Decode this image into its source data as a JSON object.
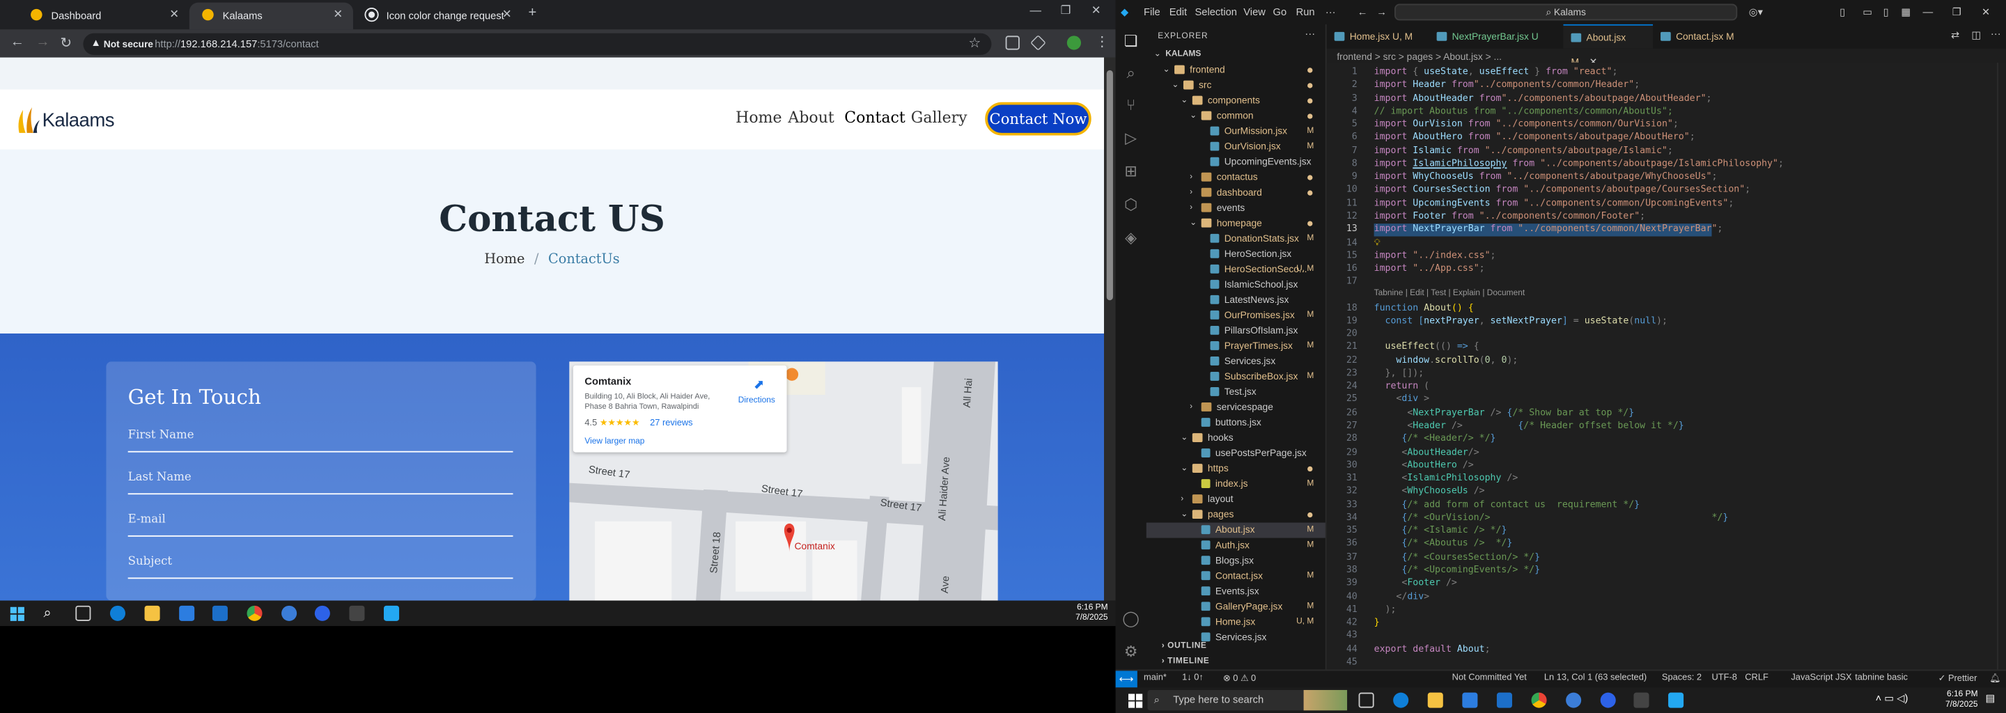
{
  "browser": {
    "tabs": [
      {
        "title": "Dashboard",
        "icon": "kalaams-favicon"
      },
      {
        "title": "Kalaams",
        "icon": "kalaams-favicon"
      },
      {
        "title": "Icon color change request",
        "icon": "chatgpt-icon"
      }
    ],
    "not_secure": "Not secure",
    "url_prefix": "http://",
    "url_host": "192.168.214.157",
    "url_path": ":5173/contact"
  },
  "site": {
    "logo_text": "Kalaams",
    "nav": [
      "Home",
      "About",
      "Contact",
      "Gallery"
    ],
    "cta": "Contact Now",
    "hero_title": "Contact US",
    "crumb_home": "Home",
    "crumb_sep": "/",
    "crumb_current": "ContactUs",
    "form_title": "Get In Touch",
    "form_fields": [
      "First Name",
      "Last Name",
      "E-mail",
      "Subject"
    ],
    "map": {
      "name": "Comtanix",
      "address": "Building 10, Ali Block, Ali Haider Ave, Phase 8 Bahria Town, Rawalpindi",
      "rating": "4.5",
      "stars": "★★★★★",
      "reviews": "27 reviews",
      "directions": "Directions",
      "larger_map": "View larger map",
      "streets": [
        "Street 17",
        "Street 17",
        "Street 17",
        "Street 18",
        "Ali Haider Ave",
        "All Hai",
        "Ave"
      ],
      "pin_label": "Comtanix"
    }
  },
  "vscode": {
    "menu": [
      "File",
      "Edit",
      "Selection",
      "View",
      "Go",
      "Run",
      "···"
    ],
    "search": "Kalams",
    "explorer_title": "EXPLORER",
    "tree": [
      {
        "name": "KALAMS",
        "depth": 0,
        "type": "root",
        "open": true
      },
      {
        "name": "frontend",
        "depth": 1,
        "type": "folder",
        "open": true,
        "status": "dot"
      },
      {
        "name": "src",
        "depth": 2,
        "type": "folder",
        "open": true,
        "status": "dot"
      },
      {
        "name": "components",
        "depth": 3,
        "type": "folder",
        "open": true,
        "status": "dot"
      },
      {
        "name": "common",
        "depth": 4,
        "type": "folder",
        "open": true,
        "status": "dot"
      },
      {
        "name": "OurMission.jsx",
        "depth": 5,
        "type": "file",
        "status": "M"
      },
      {
        "name": "OurVision.jsx",
        "depth": 5,
        "type": "file",
        "status": "M"
      },
      {
        "name": "UpcomingEvents.jsx",
        "depth": 5,
        "type": "file",
        "status": ""
      },
      {
        "name": "contactus",
        "depth": 4,
        "type": "folder",
        "open": false,
        "status": "dot"
      },
      {
        "name": "dashboard",
        "depth": 4,
        "type": "folder",
        "open": false,
        "status": "dot"
      },
      {
        "name": "events",
        "depth": 4,
        "type": "folder",
        "open": false,
        "status": ""
      },
      {
        "name": "homepage",
        "depth": 4,
        "type": "folder",
        "open": true,
        "status": "dot"
      },
      {
        "name": "DonationStats.jsx",
        "depth": 5,
        "type": "file",
        "status": "M"
      },
      {
        "name": "HeroSection.jsx",
        "depth": 5,
        "type": "file",
        "status": ""
      },
      {
        "name": "HeroSectionSeco...",
        "depth": 5,
        "type": "file",
        "status": "U, M"
      },
      {
        "name": "IslamicSchool.jsx",
        "depth": 5,
        "type": "file",
        "status": ""
      },
      {
        "name": "LatestNews.jsx",
        "depth": 5,
        "type": "file",
        "status": ""
      },
      {
        "name": "OurPromises.jsx",
        "depth": 5,
        "type": "file",
        "status": "M"
      },
      {
        "name": "PillarsOfIslam.jsx",
        "depth": 5,
        "type": "file",
        "status": ""
      },
      {
        "name": "PrayerTimes.jsx",
        "depth": 5,
        "type": "file",
        "status": "M"
      },
      {
        "name": "Services.jsx",
        "depth": 5,
        "type": "file",
        "status": ""
      },
      {
        "name": "SubscribeBox.jsx",
        "depth": 5,
        "type": "file",
        "status": "M"
      },
      {
        "name": "Test.jsx",
        "depth": 5,
        "type": "file",
        "status": ""
      },
      {
        "name": "servicespage",
        "depth": 4,
        "type": "folder",
        "open": false,
        "status": ""
      },
      {
        "name": "buttons.jsx",
        "depth": 4,
        "type": "file",
        "status": ""
      },
      {
        "name": "hooks",
        "depth": 3,
        "type": "folder",
        "open": true,
        "status": ""
      },
      {
        "name": "usePostsPerPage.jsx",
        "depth": 4,
        "type": "file",
        "status": ""
      },
      {
        "name": "https",
        "depth": 3,
        "type": "folder",
        "open": true,
        "status": "dot"
      },
      {
        "name": "index.js",
        "depth": 4,
        "type": "file",
        "status": "M"
      },
      {
        "name": "layout",
        "depth": 3,
        "type": "folder",
        "open": false,
        "status": ""
      },
      {
        "name": "pages",
        "depth": 3,
        "type": "folder",
        "open": true,
        "status": "dot"
      },
      {
        "name": "About.jsx",
        "depth": 4,
        "type": "file",
        "status": "M",
        "selected": true
      },
      {
        "name": "Auth.jsx",
        "depth": 4,
        "type": "file",
        "status": "M"
      },
      {
        "name": "Blogs.jsx",
        "depth": 4,
        "type": "file",
        "status": ""
      },
      {
        "name": "Contact.jsx",
        "depth": 4,
        "type": "file",
        "status": "M"
      },
      {
        "name": "Events.jsx",
        "depth": 4,
        "type": "file",
        "status": ""
      },
      {
        "name": "GalleryPage.jsx",
        "depth": 4,
        "type": "file",
        "status": "M"
      },
      {
        "name": "Home.jsx",
        "depth": 4,
        "type": "file",
        "status": "U, M"
      },
      {
        "name": "Services.jsx",
        "depth": 4,
        "type": "file",
        "status": ""
      }
    ],
    "outline": "OUTLINE",
    "timeline": "TIMELINE",
    "editor_tabs": [
      {
        "label": "Home.jsx",
        "status": "U, M"
      },
      {
        "label": "NextPrayerBar.jsx",
        "status": "U"
      },
      {
        "label": "About.jsx",
        "status": "M",
        "active": true
      },
      {
        "label": "Contact.jsx",
        "status": "M"
      }
    ],
    "breadcrumb": "frontend > src > pages > About.jsx > ...",
    "code_lens": "Tabnine | Edit | Test | Explain | Document",
    "status": {
      "branch": "main*",
      "sync": "1↓ 0↑",
      "problems": "⊗ 0 ⚠ 0",
      "center": "Not Committed Yet",
      "position": "Ln 13, Col 1 (63 selected)",
      "spaces": "Spaces: 2",
      "encoding": "UTF-8",
      "eol": "CRLF",
      "language": "JavaScript JSX",
      "tabnine": "tabnine basic",
      "prettier": "✓ Prettier"
    }
  },
  "taskbar": {
    "left_time": "6:16 PM",
    "left_date": "7/8/2025",
    "search_placeholder": "Type here to search",
    "right_time": "6:16 PM",
    "right_date": "7/8/2025"
  },
  "colors": {
    "brand_blue": "#0a3fc4",
    "cta_border": "#f4b400",
    "section_blue": "#3366cc",
    "vs_accent": "#0078d4",
    "modified": "#e2c08d",
    "untracked": "#73c991"
  }
}
